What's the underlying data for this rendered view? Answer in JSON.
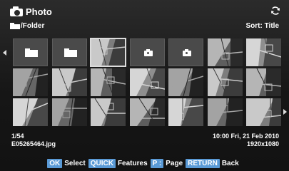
{
  "header": {
    "title": "Photo",
    "folder": "/Folder",
    "sort": "Sort: Title"
  },
  "icons": {
    "title": "camera-icon",
    "folder": "folder-icon",
    "sync": "sync-icon",
    "nav_left": "arrow-left-icon",
    "nav_right": "arrow-right-icon"
  },
  "grid": {
    "rows": [
      [
        "folder",
        "folder",
        "photo",
        "placeholder",
        "placeholder",
        "photo",
        "photo"
      ],
      [
        "photo",
        "photo",
        "photo",
        "photo",
        "photo",
        "photo",
        "photo"
      ],
      [
        "photo",
        "photo",
        "photo",
        "photo",
        "photo",
        "photo",
        "photo"
      ]
    ],
    "selected": [
      0,
      2
    ]
  },
  "info": {
    "position": "1/54",
    "filename": "E05265464.jpg",
    "datetime": "10:00 Fri, 21 Feb 2010",
    "resolution": "1920x1080"
  },
  "footer": {
    "ok_key": "OK",
    "ok_label": "Select",
    "quick_key": "QUICK",
    "quick_label": "Features",
    "p_key": "P :",
    "p_label": "Page",
    "return_key": "RETURN",
    "return_label": "Back"
  },
  "colors": {
    "key_bg": "#5a9ad6",
    "selection": "#dcdcdc",
    "tile_bg": "#4a4a4a"
  }
}
